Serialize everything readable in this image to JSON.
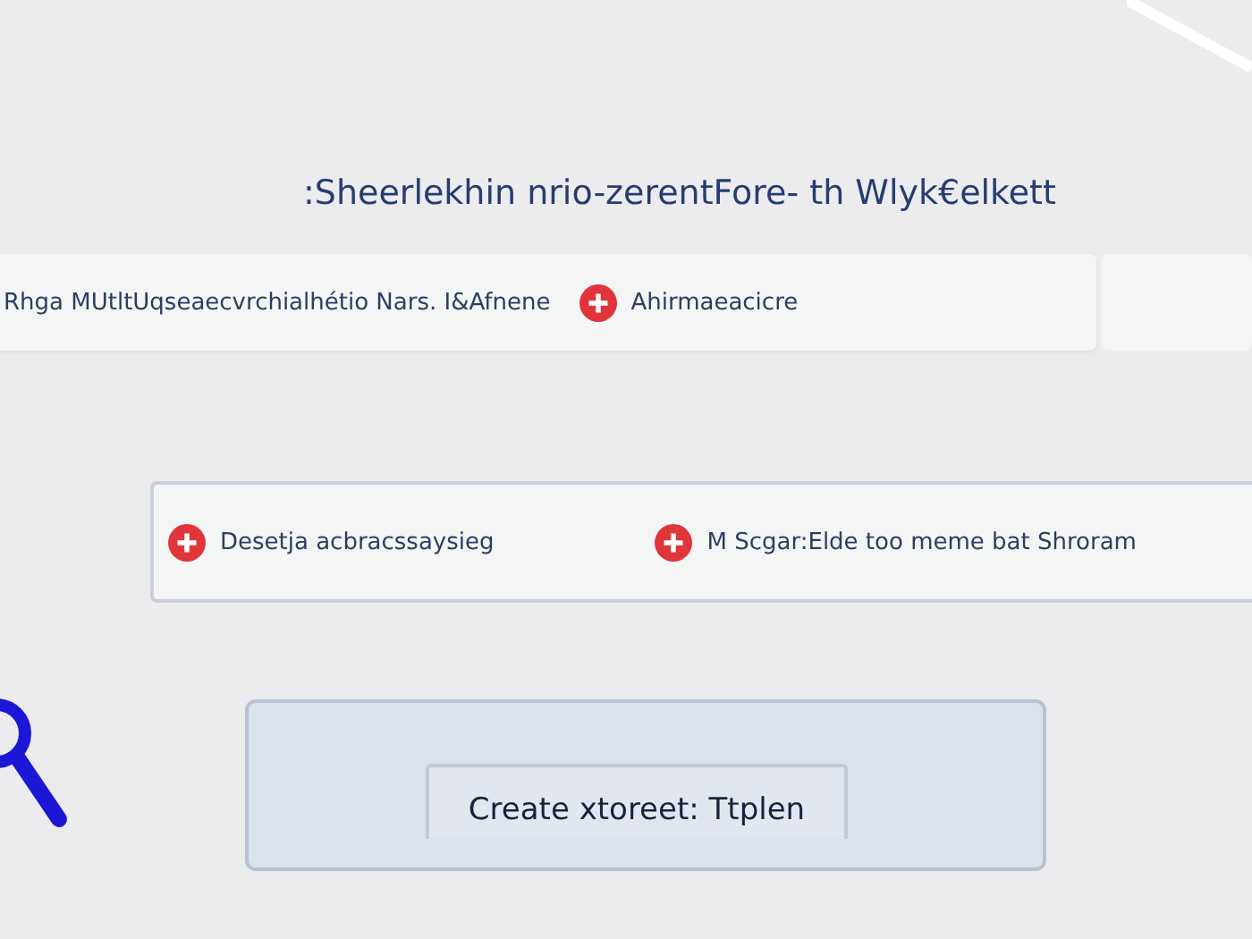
{
  "heading": ":Sheerlekhin nrio-zerentFore- th Wlyk€elkett",
  "info_bar": {
    "items": [
      {
        "kind": "text",
        "text": "Rhga MUtltUqseaecvrchialhétio Nars. I&Afnene"
      },
      {
        "kind": "alert",
        "text": "Ahirmaeacicre"
      }
    ]
  },
  "warning_bar": {
    "items": [
      {
        "kind": "alert",
        "text": "Desetja acbracssaysieg"
      },
      {
        "kind": "alert",
        "text": "M Scgar:Elde too meme bat Shroram"
      }
    ]
  },
  "create_button": {
    "label": "Create xtoreet: Ttplen"
  }
}
